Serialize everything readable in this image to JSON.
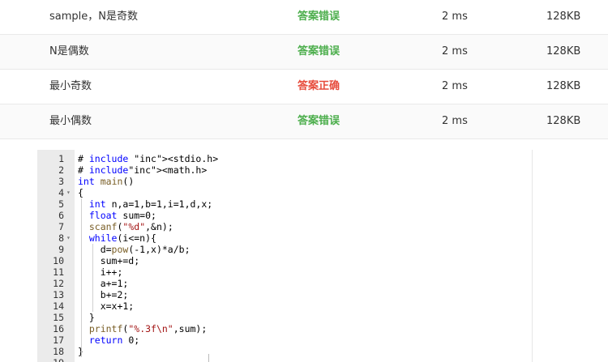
{
  "results": [
    {
      "name": "sample，N是奇数",
      "status": "答案错误",
      "status_color": "#4cae4c",
      "time": "2 ms",
      "memory": "128KB"
    },
    {
      "name": "N是偶数",
      "status": "答案错误",
      "status_color": "#4cae4c",
      "time": "2 ms",
      "memory": "128KB"
    },
    {
      "name": "最小奇数",
      "status": "答案正确",
      "status_color": "#e74c3c",
      "time": "2 ms",
      "memory": "128KB"
    },
    {
      "name": "最小偶数",
      "status": "答案错误",
      "status_color": "#4cae4c",
      "time": "2 ms",
      "memory": "128KB"
    }
  ],
  "code": {
    "lines": [
      {
        "n": "1",
        "fold": "",
        "text": "# include <stdio.h>"
      },
      {
        "n": "2",
        "fold": "",
        "text": "# include<math.h>"
      },
      {
        "n": "3",
        "fold": "",
        "text": "int main()"
      },
      {
        "n": "4",
        "fold": "▾",
        "text": "{"
      },
      {
        "n": "5",
        "fold": "",
        "text": "  int n,a=1,b=1,i=1,d,x;"
      },
      {
        "n": "6",
        "fold": "",
        "text": "  float sum=0;"
      },
      {
        "n": "7",
        "fold": "",
        "text": "  scanf(\"%d\",&n);"
      },
      {
        "n": "8",
        "fold": "▾",
        "text": "  while(i<=n){"
      },
      {
        "n": "9",
        "fold": "",
        "text": "    d=pow(-1,x)*a/b;"
      },
      {
        "n": "10",
        "fold": "",
        "text": "    sum+=d;"
      },
      {
        "n": "11",
        "fold": "",
        "text": "    i++;"
      },
      {
        "n": "12",
        "fold": "",
        "text": "    a+=1;"
      },
      {
        "n": "13",
        "fold": "",
        "text": "    b+=2;"
      },
      {
        "n": "14",
        "fold": "",
        "text": "    x=x+1;"
      },
      {
        "n": "15",
        "fold": "",
        "text": "  }"
      },
      {
        "n": "16",
        "fold": "",
        "text": "  printf(\"%.3f\\n\",sum);"
      },
      {
        "n": "17",
        "fold": "",
        "text": "  return 0;"
      },
      {
        "n": "18",
        "fold": "",
        "text": "}"
      },
      {
        "n": "19",
        "fold": "",
        "text": ""
      }
    ]
  }
}
